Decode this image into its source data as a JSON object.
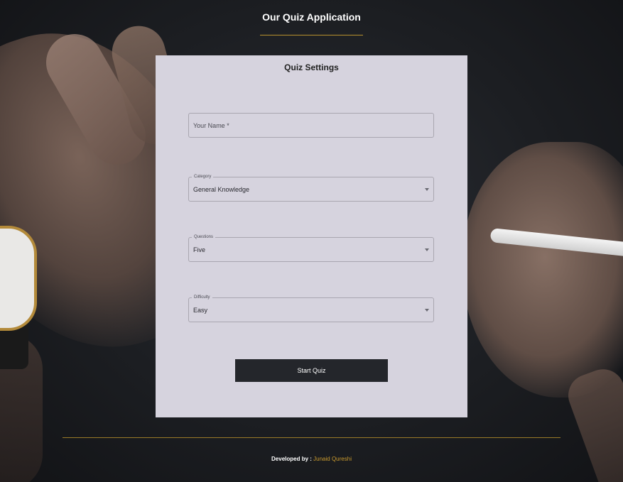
{
  "app": {
    "title": "Our Quiz Application"
  },
  "settings_card": {
    "title": "Quiz Settings",
    "name_field": {
      "placeholder": "Your Name *",
      "value": ""
    },
    "category": {
      "label": "Category",
      "selected": "General Knowledge"
    },
    "questions": {
      "label": "Questions",
      "selected": "Five"
    },
    "difficulty": {
      "label": "Difficulty",
      "selected": "Easy"
    },
    "start_button_label": "Start Quiz"
  },
  "footer": {
    "prefix": "Developed by : ",
    "author": "Junaid Qureshi"
  },
  "colors": {
    "accent": "#b8922e",
    "card_background": "#d6d3de",
    "button_background": "#24262b"
  },
  "icons": {
    "dropdown": "chevron-down-icon"
  }
}
